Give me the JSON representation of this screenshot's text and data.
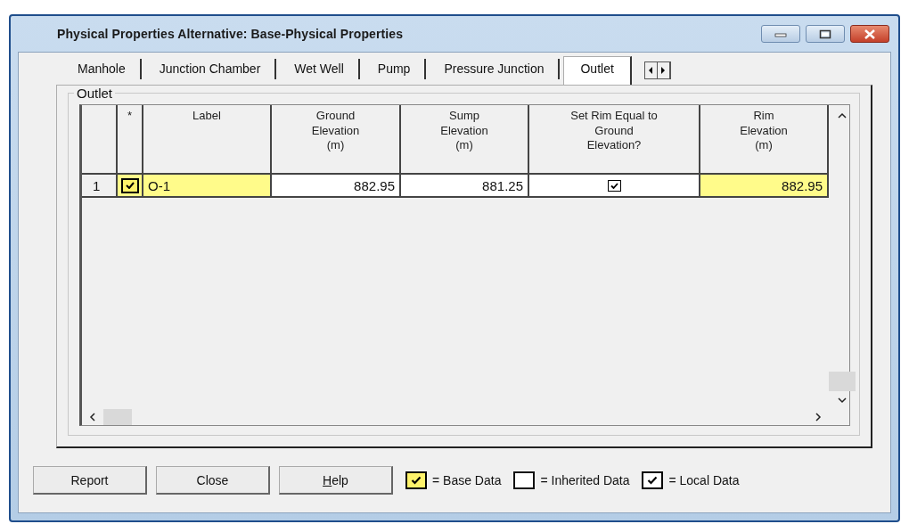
{
  "window": {
    "title": "Physical Properties Alternative: Base-Physical Properties"
  },
  "tabs": [
    {
      "label": "Manhole",
      "selected": false
    },
    {
      "label": "Junction Chamber",
      "selected": false
    },
    {
      "label": "Wet Well",
      "selected": false
    },
    {
      "label": "Pump",
      "selected": false
    },
    {
      "label": "Pressure Junction",
      "selected": false
    },
    {
      "label": "Outlet",
      "selected": true
    }
  ],
  "group": {
    "title": "Outlet"
  },
  "table": {
    "columns": [
      "*",
      "Label",
      "Ground Elevation (m)",
      "Sump Elevation (m)",
      "Set Rim Equal to Ground Elevation?",
      "Rim Elevation (m)"
    ],
    "rows": [
      {
        "number": "1",
        "base_checked": true,
        "label": "O-1",
        "ground_elevation": "882.95",
        "sump_elevation": "881.25",
        "set_rim_equal": true,
        "rim_elevation": "882.95",
        "rim_highlighted": true
      }
    ]
  },
  "buttons": [
    {
      "label": "Report"
    },
    {
      "label": "Close"
    },
    {
      "label": "Help",
      "mnemonic": true
    }
  ],
  "legend": [
    {
      "kind": "base",
      "checked": true,
      "label": "= Base Data"
    },
    {
      "kind": "inherited",
      "checked": false,
      "label": "= Inherited Data"
    },
    {
      "kind": "local",
      "checked": true,
      "label": "= Local Data"
    }
  ]
}
